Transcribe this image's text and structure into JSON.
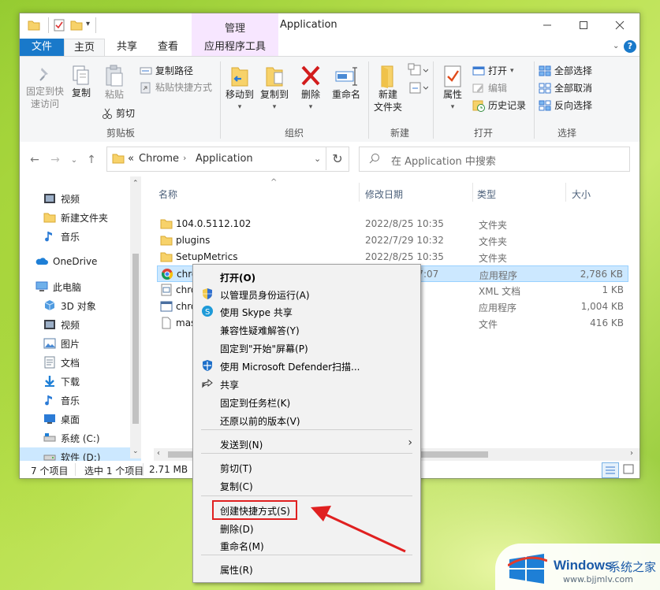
{
  "window": {
    "title": "Application",
    "contextual_group": "管理",
    "tabs": [
      "文件",
      "主页",
      "共享",
      "查看",
      "应用程序工具"
    ],
    "active_tab": "主页"
  },
  "ribbon": {
    "clipboard": {
      "pin_label_line1": "固定到快",
      "pin_label_line2": "速访问",
      "copy_label": "复制",
      "paste_label": "粘贴",
      "copy_path_label": "复制路径",
      "paste_shortcut_label": "粘贴快捷方式",
      "cut_label": "剪切",
      "group_label": "剪贴板"
    },
    "organize": {
      "move_line1": "移动到",
      "copy_line1": "复制到",
      "delete_label": "删除",
      "rename_label": "重命名",
      "group_label": "组织"
    },
    "new": {
      "new_folder_line1": "新建",
      "new_folder_line2": "文件夹",
      "group_label": "新建"
    },
    "open": {
      "properties_label": "属性",
      "open_label": "打开",
      "edit_label": "编辑",
      "history_label": "历史记录",
      "group_label": "打开"
    },
    "select": {
      "select_all": "全部选择",
      "select_none": "全部取消",
      "invert": "反向选择",
      "group_label": "选择"
    }
  },
  "address": {
    "path_prefix": "«",
    "segment1": "Chrome",
    "segment2": "Application",
    "search_placeholder": "在 Application 中搜索"
  },
  "nav": {
    "items": [
      {
        "label": "视频",
        "icon": "video-folder-icon"
      },
      {
        "label": "新建文件夹",
        "icon": "folder-icon"
      },
      {
        "label": "音乐",
        "icon": "music-icon"
      },
      {
        "label": "OneDrive",
        "icon": "onedrive-icon"
      },
      {
        "label": "此电脑",
        "icon": "computer-icon"
      },
      {
        "label": "3D 对象",
        "icon": "3d-objects-icon"
      },
      {
        "label": "视频",
        "icon": "video-folder-icon"
      },
      {
        "label": "图片",
        "icon": "pictures-icon"
      },
      {
        "label": "文档",
        "icon": "documents-icon"
      },
      {
        "label": "下载",
        "icon": "download-icon"
      },
      {
        "label": "音乐",
        "icon": "music-icon"
      },
      {
        "label": "桌面",
        "icon": "desktop-icon"
      },
      {
        "label": "系统 (C:)",
        "icon": "system-drive-icon"
      },
      {
        "label": "软件 (D:)",
        "icon": "drive-icon"
      }
    ]
  },
  "files": {
    "columns": {
      "name": "名称",
      "date": "修改日期",
      "type": "类型",
      "size": "大小"
    },
    "rows": [
      {
        "name": "104.0.5112.102",
        "date": "2022/8/25 10:35",
        "type": "文件夹",
        "size": ""
      },
      {
        "name": "plugins",
        "date": "2022/7/29 10:32",
        "type": "文件夹",
        "size": ""
      },
      {
        "name": "SetupMetrics",
        "date": "2022/8/25 10:35",
        "type": "文件夹",
        "size": ""
      },
      {
        "name": "chrome",
        "date": "2022/8/16 7:07",
        "type": "应用程序",
        "size": "2,786 KB"
      },
      {
        "name": "chro",
        "date": "31",
        "type": "XML 文档",
        "size": "1 KB"
      },
      {
        "name": "chro",
        "date": "07",
        "type": "应用程序",
        "size": "1,004 KB"
      },
      {
        "name": "mas",
        "date": "1:44",
        "type": "文件",
        "size": "416 KB"
      }
    ]
  },
  "status": {
    "item_count": "7 个项目",
    "selected": "选中 1 个项目",
    "size": "2.71 MB"
  },
  "context_menu": {
    "items": [
      {
        "label": "打开(O)",
        "bold": true
      },
      {
        "label": "以管理员身份运行(A)"
      },
      {
        "label": "使用 Skype 共享"
      },
      {
        "label": "兼容性疑难解答(Y)"
      },
      {
        "label": "固定到\"开始\"屏幕(P)"
      },
      {
        "label": "使用 Microsoft Defender扫描..."
      },
      {
        "label": "共享"
      },
      {
        "label": "固定到任务栏(K)"
      },
      {
        "label": "还原以前的版本(V)"
      },
      {
        "label": "发送到(N)"
      },
      {
        "label": "剪切(T)"
      },
      {
        "label": "复制(C)"
      },
      {
        "label": "创建快捷方式(S)"
      },
      {
        "label": "删除(D)"
      },
      {
        "label": "重命名(M)"
      },
      {
        "label": "属性(R)"
      }
    ]
  },
  "watermark": {
    "brand": "Windows",
    "brand_cn": "系统之家",
    "url": "www.bjjmlv.com"
  },
  "colors": {
    "accent": "#1979ca",
    "selection": "#cce8ff",
    "annotation": "#e02020"
  }
}
